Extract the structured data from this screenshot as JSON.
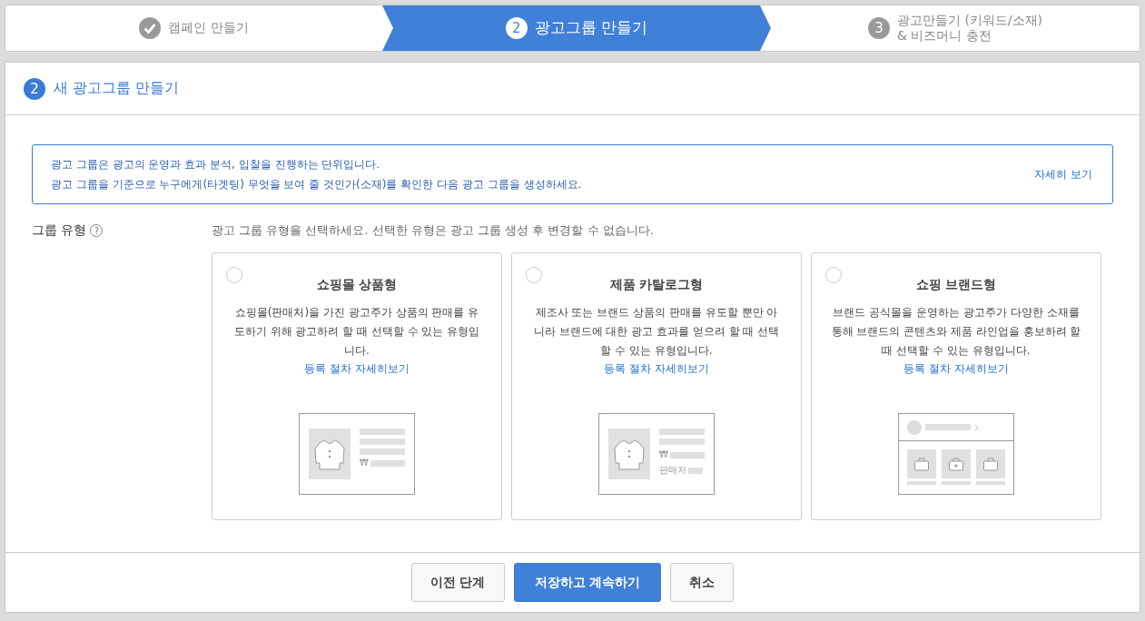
{
  "steps": [
    {
      "label": "캠페인 만들기",
      "done": true,
      "selected": false
    },
    {
      "number": "2",
      "label": "광고그룹 만들기",
      "done": false,
      "selected": true
    },
    {
      "number": "3",
      "label": "광고만들기 (키워드/소재)\n& 비즈머니 충전",
      "done": false,
      "selected": false
    }
  ],
  "panel": {
    "number": "2",
    "title": "새 광고그룹 만들기"
  },
  "notice": {
    "lines": [
      "광고 그룹은 광고의 운영과 효과 분석, 입찰을 진행하는 단위입니다.",
      "광고 그룹을 기준으로 누구에게(타겟팅) 무엇을 보여 줄 것인가(소재)를 확인한 다음 광고 그룹을 생성하세요."
    ],
    "link": "자세히 보기"
  },
  "group_type": {
    "label": "그룹 유형",
    "hint": "?",
    "instruction": "광고 그룹 유형을 선택하세요. 선택한 유형은 광고 그룹 생성 후 변경할 수 없습니다.",
    "cards": [
      {
        "title": "쇼핑몰 상품형",
        "description": "쇼핑몰(판매처)을 가진 광고주가 상품의 판매를 유도하기 위해 광고하려 할 때 선택할 수 있는 유형입니다.",
        "link": "등록 절차 자세히보기",
        "selected": false,
        "kind": "product",
        "price_mark": "₩"
      },
      {
        "title": "제품 카탈로그형",
        "description": "제조사 또는 브랜드 상품의 판매를 유도할 뿐만 아니라 브랜드에 대한 광고 효과를 얻으려 할 때 선택할 수 있는 유형입니다.",
        "link": "등록 절차 자세히보기",
        "selected": false,
        "kind": "catalog",
        "price_mark": "₩",
        "seller_label": "판매처"
      },
      {
        "title": "쇼핑 브랜드형",
        "description": "브랜드 공식몰을 운영하는 광고주가 다양한 소재를 통해 브랜드의 콘텐츠와 제품 라인업을 홍보하려 할 때 선택할 수 있는 유형입니다.",
        "link": "등록 절차 자세히보기",
        "selected": false,
        "kind": "brand"
      }
    ]
  },
  "buttons": [
    {
      "label": "이전 단계",
      "kind": "secondary"
    },
    {
      "label": "저장하고 계속하기",
      "kind": "primary"
    },
    {
      "label": "취소",
      "kind": "secondary"
    }
  ]
}
